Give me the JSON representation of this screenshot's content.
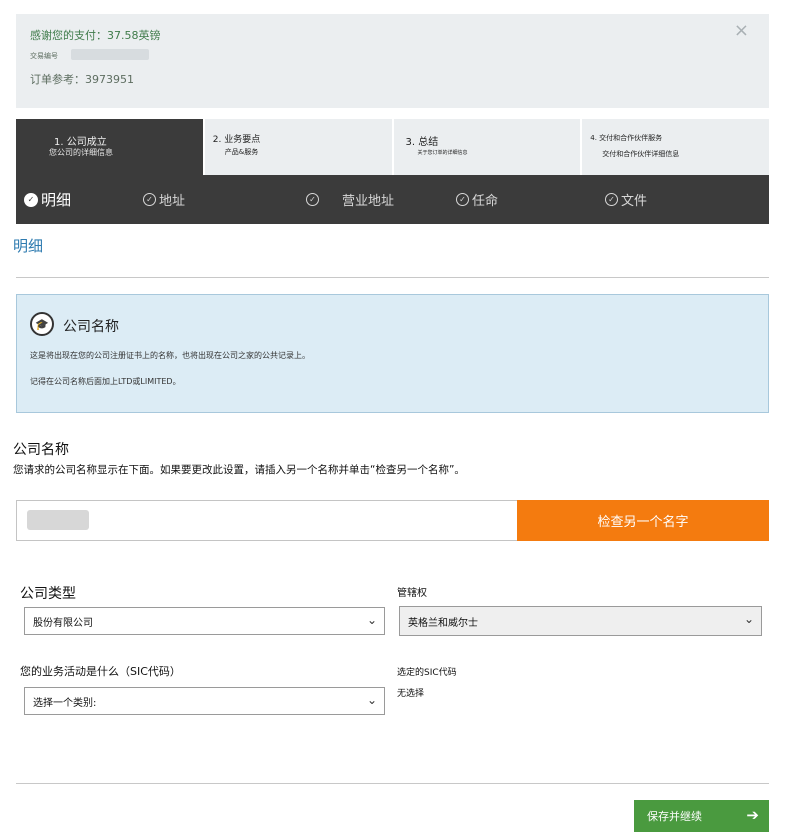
{
  "payment_notice": {
    "thanks": "感谢您的支付：37.58英镑",
    "transaction_label": "交易编号",
    "order_ref": "订单参考：3973951",
    "close": "×"
  },
  "steps": [
    {
      "title": "1. 公司成立",
      "subtitle": "您公司的详细信息"
    },
    {
      "title": "2. 业务要点",
      "subtitle": "产品&服务"
    },
    {
      "title": "3. 总结",
      "subtitle": "关于您订单的详细信息"
    },
    {
      "title": "4. 交付和合作伙伴服务",
      "subtitle": "交付和合作伙伴详细信息"
    }
  ],
  "subnav": [
    {
      "label": "明细",
      "icon": "check-circle-icon"
    },
    {
      "label": "地址",
      "icon": "check-circle-icon"
    },
    {
      "label": "营业地址",
      "icon": "check-circle-icon"
    },
    {
      "label": "任命",
      "icon": "check-circle-icon"
    },
    {
      "label": "文件",
      "icon": "check-circle-icon"
    }
  ],
  "section_title": "明细",
  "info_box": {
    "icon": "graduation-cap-icon",
    "title": "公司名称",
    "para1": "这是将出现在您的公司注册证书上的名称，也将出现在公司之家的公共记录上。",
    "para2": "记得在公司名称后面加上LTD或LIMITED。"
  },
  "company_name": {
    "label": "公司名称",
    "description": "您请求的公司名称显示在下面。如果要更改此设置，请插入另一个名称并单击“检查另一个名称”。",
    "check_button": "检查另一个名字"
  },
  "company_type": {
    "label": "公司类型",
    "value": "股份有限公司"
  },
  "jurisdiction": {
    "label": "管辖权",
    "value": "英格兰和威尔士"
  },
  "sic": {
    "label": "您的业务活动是什么（SIC代码）",
    "value": "选择一个类别:"
  },
  "selected_sic": {
    "label": "选定的SIC代码",
    "value": "无选择"
  },
  "save_button": "保存并继续",
  "colors": {
    "accent_orange": "#f47b0f",
    "accent_green": "#4a9a3f",
    "nav_dark": "#3b3b3b",
    "info_bg": "#dcecf5"
  }
}
